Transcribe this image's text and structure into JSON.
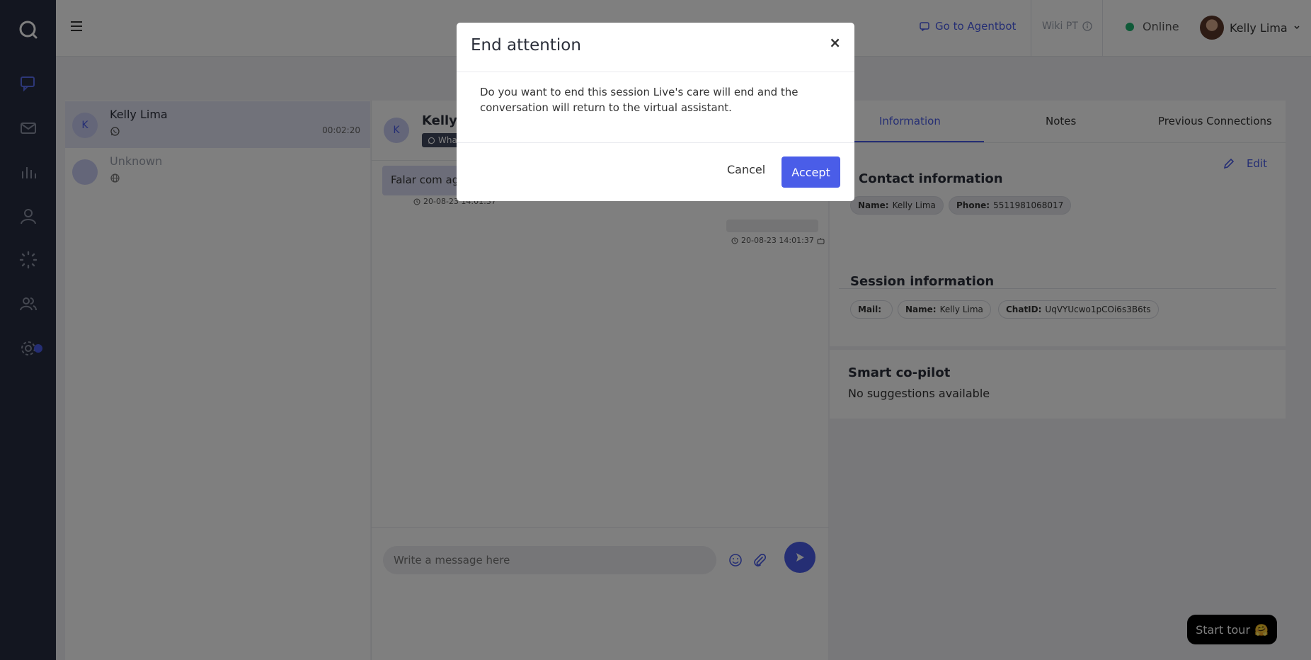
{
  "header": {
    "agentbot_link": "Go to Agentbot",
    "wiki_label": "Wiki PT",
    "status_label": "Online",
    "user_name": "Kelly Lima"
  },
  "conversations": [
    {
      "avatar_letter": "K",
      "name": "Kelly Lima",
      "channel_icon": "whatsapp-icon",
      "elapsed": "00:02:20",
      "active": true
    },
    {
      "avatar_letter": "",
      "name": "Unknown",
      "channel_icon": "globe-icon",
      "elapsed": "",
      "active": false
    }
  ],
  "chat": {
    "avatar_letter": "K",
    "contact_name": "Kelly L",
    "channel_tag": "Wha",
    "messages": [
      {
        "direction": "in",
        "text": "Falar com ag",
        "timestamp": "20-08-23 14:01:37"
      },
      {
        "direction": "out",
        "text": "",
        "timestamp": "20-08-23 14:01:37"
      }
    ],
    "input_placeholder": "Write a message here"
  },
  "info": {
    "tabs": [
      "Information",
      "Notes",
      "Previous Connections"
    ],
    "active_tab": "Information",
    "edit_label": "Edit",
    "contact_title": "Contact information",
    "contact_chips": [
      {
        "key": "Name:",
        "value": "Kelly Lima"
      },
      {
        "key": "Phone:",
        "value": "5511981068017"
      }
    ],
    "session_title": "Session information",
    "session_chips": [
      {
        "key": "Mail:",
        "value": ""
      },
      {
        "key": "Name:",
        "value": "Kelly Lima"
      },
      {
        "key": "ChatID:",
        "value": "UqVYUcwo1pCOi6s3B6ts"
      }
    ],
    "copilot_title": "Smart co-pilot",
    "copilot_text": "No suggestions available"
  },
  "tour": {
    "label": "Start tour",
    "emoji": "🤗"
  },
  "modal": {
    "title": "End attention",
    "close_glyph": "×",
    "body": "Do you want to end this session Live's care will end and the conversation will return to the virtual assistant.",
    "cancel_label": "Cancel",
    "accept_label": "Accept"
  },
  "colors": {
    "rail": "#262c41",
    "accent": "#4a5de8",
    "online": "#1fb470",
    "overlay": "rgba(0,0,0,0.5)"
  }
}
